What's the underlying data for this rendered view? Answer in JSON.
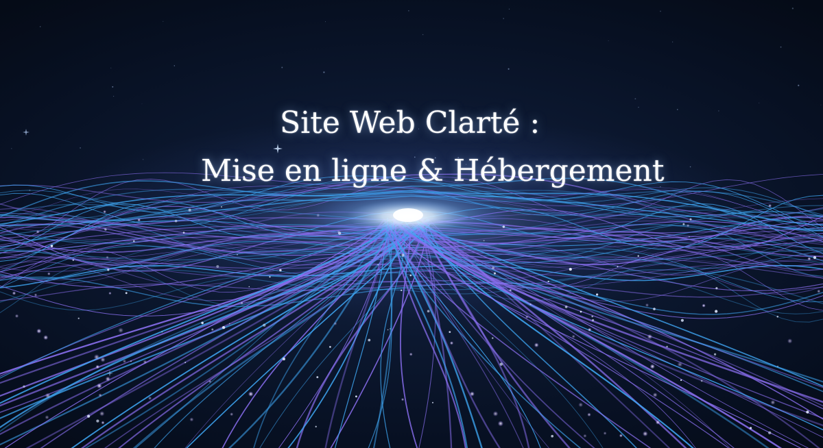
{
  "hero": {
    "title_line1": "Site Web Clarté :",
    "title_line2": "Mise en ligne & Hébergement"
  },
  "colors": {
    "background": "#06101e",
    "fiber_blue": "#3ea4f0",
    "fiber_violet": "#8a6ff0",
    "glow": "#e8f2ff",
    "title_text": "#ffffff"
  }
}
